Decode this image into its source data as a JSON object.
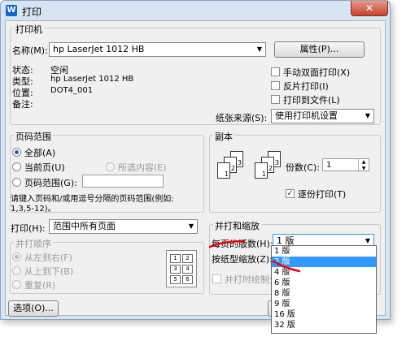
{
  "window": {
    "title": "打印",
    "icon_text": "W",
    "close_glyph": "✕"
  },
  "printer": {
    "group_label": "打印机",
    "name_label": "名称(M):",
    "name_value": "hp LaserJet 1012 HB",
    "properties_button": "属性(P)...",
    "status_label": "状态:",
    "status_value": "空闲",
    "type_label": "类型:",
    "type_value": "hp LaserJet 1012 HB",
    "location_label": "位置:",
    "location_value": "DOT4_001",
    "comment_label": "备注:",
    "manual_duplex": "手动双面打印(X)",
    "reverse_print": "反片打印(I)",
    "print_to_file": "打印到文件(L)",
    "paper_source_label": "纸张来源(S):",
    "paper_source_value": "使用打印机设置"
  },
  "page_range": {
    "group_label": "页码范围",
    "all": "全部(A)",
    "current": "当前页(U)",
    "selection": "所选内容(E)",
    "pages": "页码范围(G):",
    "hint_line1": "请键入页码和/或用逗号分隔的页码范围(例如:",
    "hint_line2": "1,3,5-12)。"
  },
  "print_what": {
    "label": "打印(H):",
    "value": "范围中所有页面",
    "order_label": "并打顺序",
    "left_to_right": "从左到右(F)",
    "top_to_bottom": "从上到下(B)",
    "repeat": "重复(R)",
    "grid_numbers": [
      "1",
      "2",
      "3",
      "4",
      "5",
      "6"
    ]
  },
  "copies": {
    "group_label": "副本",
    "copies_label": "份数(C):",
    "copies_value": "1",
    "collate": "逐份打印(T)",
    "page_numbers": [
      "3",
      "2",
      "1",
      "3",
      "2",
      "1"
    ]
  },
  "zoom": {
    "group_label": "并打和缩放",
    "pages_per_sheet_label": "每页的版数(H):",
    "pages_per_sheet_value": "1 版",
    "scale_to_paper_label": "按纸型缩放(Z):",
    "draw_borders": "并打时绘制分",
    "options": [
      "1 版",
      "2 版",
      "4 版",
      "6 版",
      "8 版",
      "9 版",
      "16 版",
      "32 版"
    ],
    "selected_index": 1
  },
  "footer": {
    "options_button": "选项(O)..."
  },
  "colors": {
    "annotation": "#e60012"
  }
}
